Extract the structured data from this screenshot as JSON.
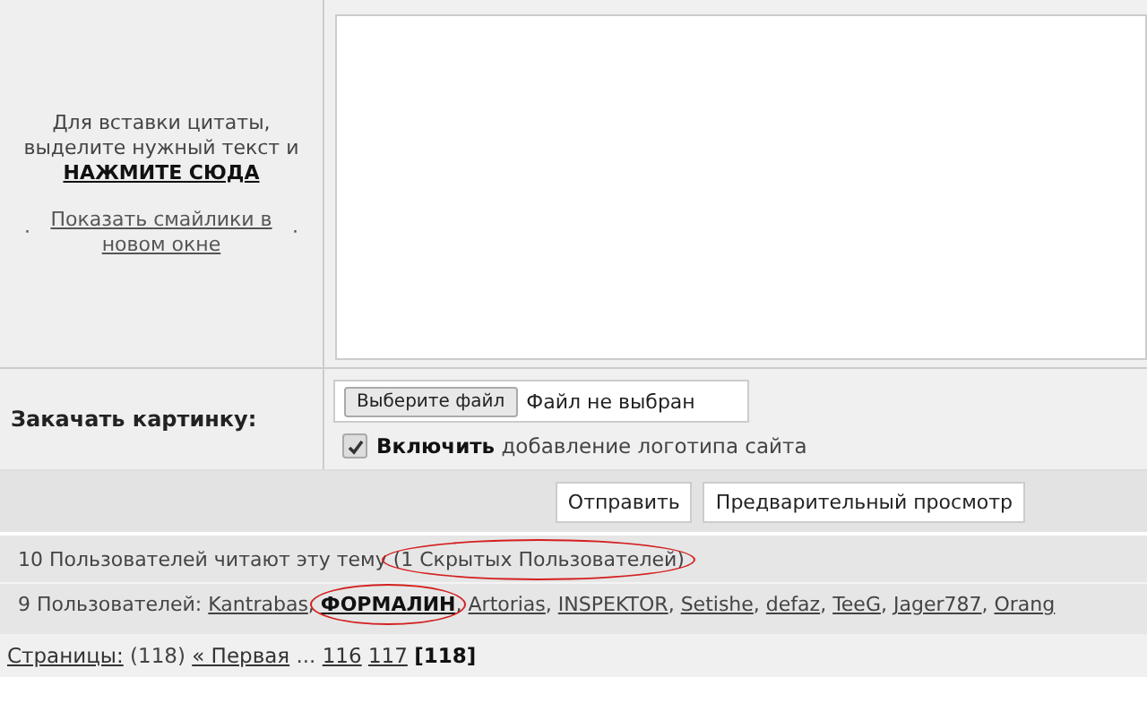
{
  "quote_help": {
    "text": "Для вставки цитаты, выделите нужный текст и",
    "link": "НАЖМИТЕ СЮДА"
  },
  "smilies": {
    "bullet_left": "·",
    "link": "Показать смайлики в новом окне",
    "bullet_right": "·"
  },
  "upload": {
    "label": "Закачать картинку:",
    "file_button": "Выберите файл",
    "file_status": "Файл не выбран",
    "logo_checkbox": {
      "label": "**Включить** добавление логотипа сайта",
      "checked": true
    }
  },
  "buttons": [
    {
      "label": "Отправить"
    },
    {
      "label": "Предварительный просмотр"
    }
  ],
  "readers": {
    "text": "10 Пользователей читают эту тему",
    "hidden": "(1 Скрытых Пользователей)",
    "hidden_circled": true
  },
  "users": {
    "label": "9 Пользователей:",
    "list": [
      {
        "name": "Kantrabas",
        "separator": ",",
        "bold": false,
        "circled": false
      },
      {
        "name": "ФОРМАЛИН",
        "separator": ",",
        "bold": true,
        "circled": true
      },
      {
        "name": "Artorias",
        "separator": ",",
        "bold": false,
        "circled": false
      },
      {
        "name": "INSPEKTOR",
        "separator": ",",
        "bold": false,
        "circled": false
      },
      {
        "name": "Setishe",
        "separator": ",",
        "bold": false,
        "circled": false
      },
      {
        "name": "defaz",
        "separator": ",",
        "bold": false,
        "circled": false
      },
      {
        "name": "TeeG",
        "separator": ",",
        "bold": false,
        "circled": false
      },
      {
        "name": "Jager787",
        "separator": ",",
        "bold": false,
        "circled": false
      },
      {
        "name": "Orang",
        "bold": false,
        "circled": false
      }
    ]
  },
  "pages": {
    "label": "Страницы:",
    "count": "(118)",
    "first": "« Первая",
    "ellipsis": "...",
    "links": [
      {
        "label": "116",
        "selected": false
      },
      {
        "label": "117",
        "selected": false
      },
      {
        "label": "[118]",
        "selected": true
      }
    ]
  }
}
